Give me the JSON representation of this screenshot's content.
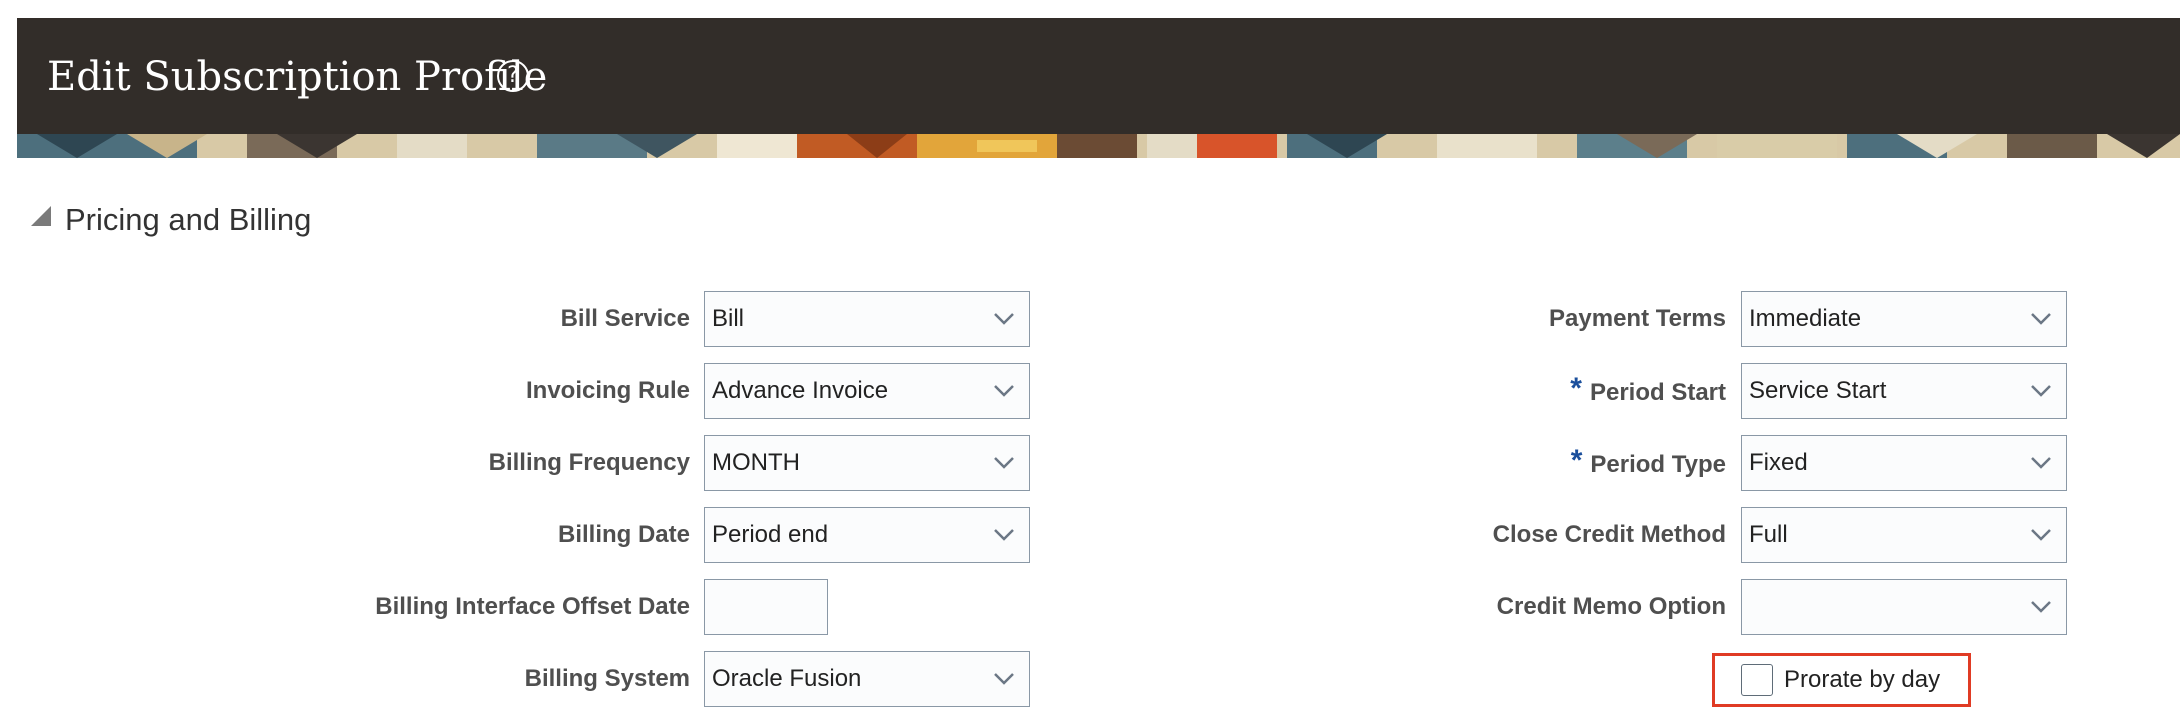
{
  "header": {
    "title": "Edit Subscription Profile",
    "help_icon": "?"
  },
  "section": {
    "title": "Pricing and Billing",
    "toggle_icon": "collapse-triangle-icon"
  },
  "left_fields": {
    "bill_service": {
      "label": "Bill Service",
      "value": "Bill"
    },
    "invoicing_rule": {
      "label": "Invoicing Rule",
      "value": "Advance Invoice"
    },
    "billing_frequency": {
      "label": "Billing Frequency",
      "value": "MONTH"
    },
    "billing_date": {
      "label": "Billing Date",
      "value": "Period end"
    },
    "billing_interface_offset_date": {
      "label": "Billing Interface Offset Date",
      "value": ""
    },
    "billing_system": {
      "label": "Billing System",
      "value": "Oracle Fusion"
    }
  },
  "right_fields": {
    "payment_terms": {
      "label": "Payment Terms",
      "value": "Immediate"
    },
    "period_start": {
      "label": "Period Start",
      "value": "Service Start",
      "required_marker": "*"
    },
    "period_type": {
      "label": "Period Type",
      "value": "Fixed",
      "required_marker": "*"
    },
    "close_credit_method": {
      "label": "Close Credit Method",
      "value": "Full"
    },
    "credit_memo_option": {
      "label": "Credit Memo Option",
      "value": ""
    }
  },
  "prorate": {
    "label": "Prorate by day",
    "checked": false
  },
  "colors": {
    "header_bg": "#322d29",
    "required_marker": "#1b4f9c",
    "highlight_border": "#e03b24",
    "field_border": "#8a98a6"
  }
}
